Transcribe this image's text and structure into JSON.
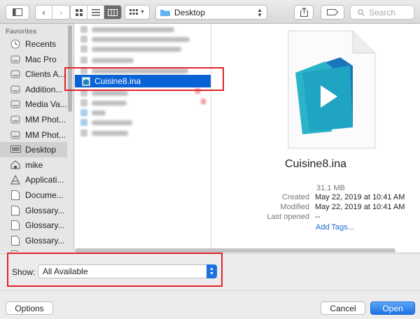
{
  "toolbar": {
    "location_label": "Desktop",
    "search_placeholder": "Search"
  },
  "sidebar": {
    "heading": "Favorites",
    "items": [
      {
        "label": "Recents",
        "icon": "clock-icon"
      },
      {
        "label": "Mac Pro",
        "icon": "drive-icon"
      },
      {
        "label": "Clients A...",
        "icon": "drive-icon"
      },
      {
        "label": "Addition...",
        "icon": "drive-icon"
      },
      {
        "label": "Media Va...",
        "icon": "drive-icon"
      },
      {
        "label": "MM Phot...",
        "icon": "drive-icon"
      },
      {
        "label": "MM Phot...",
        "icon": "drive-icon"
      },
      {
        "label": "Desktop",
        "icon": "desktop-icon",
        "selected": true
      },
      {
        "label": "mike",
        "icon": "home-icon"
      },
      {
        "label": "Applicati...",
        "icon": "applications-icon"
      },
      {
        "label": "Docume...",
        "icon": "document-icon"
      },
      {
        "label": "Glossary...",
        "icon": "document-icon"
      },
      {
        "label": "Glossary...",
        "icon": "document-icon"
      },
      {
        "label": "Glossary...",
        "icon": "document-icon"
      },
      {
        "label": "Glossary...",
        "icon": "document-icon"
      }
    ]
  },
  "file_list": {
    "selected_file": "Cuisine8.ina"
  },
  "preview": {
    "name": "Cuisine8.ina",
    "size": "31.1 MB",
    "created_key": "Created",
    "created_val": "May 22, 2019 at 10:41 AM",
    "modified_key": "Modified",
    "modified_val": "May 22, 2019 at 10:41 AM",
    "last_opened_key": "Last opened",
    "last_opened_val": "--",
    "add_tags": "Add Tags..."
  },
  "bottom": {
    "show_label": "Show:",
    "show_value": "All Available",
    "options_label": "Options",
    "cancel_label": "Cancel",
    "open_label": "Open"
  },
  "colors": {
    "selection": "#0a63d6",
    "highlight_box": "#e3232b",
    "link": "#1a66d2"
  }
}
